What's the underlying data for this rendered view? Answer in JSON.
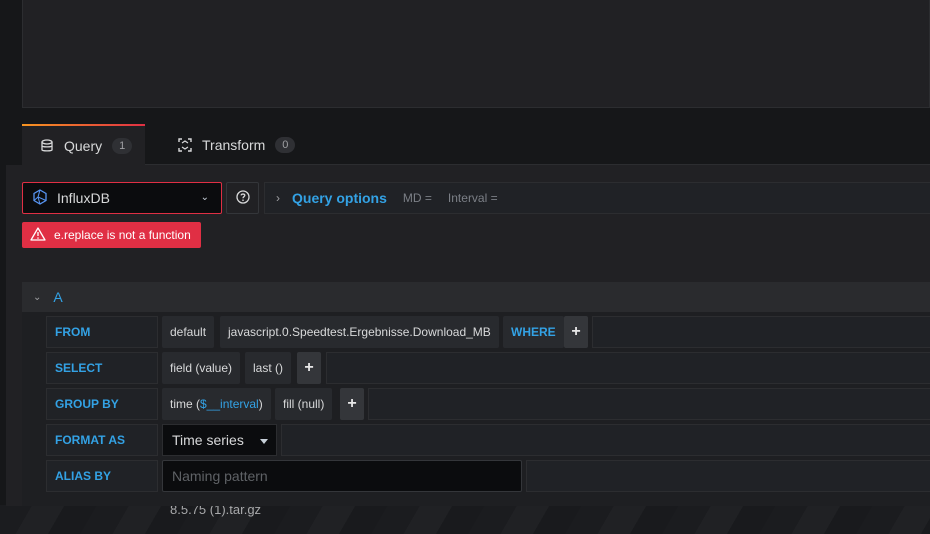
{
  "background": {
    "file_text": "8.5.75 (1).tar.gz"
  },
  "tabs": [
    {
      "label": "Query",
      "count": "1",
      "icon": "database-icon"
    },
    {
      "label": "Transform",
      "count": "0",
      "icon": "transform-icon"
    }
  ],
  "datasource": {
    "name": "InfluxDB",
    "icon": "influxdb-icon",
    "error": "e.replace is not a function"
  },
  "query_options": {
    "title": "Query options",
    "md": "MD =",
    "interval": "Interval ="
  },
  "query": {
    "ref_id": "A",
    "from": {
      "label": "FROM",
      "policy": "default",
      "measurement": "javascript.0.Speedtest.Ergebnisse.Download_MB",
      "where": "WHERE"
    },
    "select": {
      "label": "SELECT",
      "field": "field (value)",
      "func": "last ()"
    },
    "group_by": {
      "label": "GROUP BY",
      "time_prefix": "time (",
      "time_var": "$__interval",
      "time_suffix": ")",
      "fill": "fill (null)"
    },
    "format_as": {
      "label": "FORMAT AS",
      "value": "Time series"
    },
    "alias_by": {
      "label": "ALIAS BY",
      "placeholder": "Naming pattern"
    }
  },
  "colors": {
    "accent_blue": "#33a2e5",
    "error_red": "#e02f44",
    "tab_gradient_start": "#f79520",
    "panel_bg": "#212124"
  }
}
